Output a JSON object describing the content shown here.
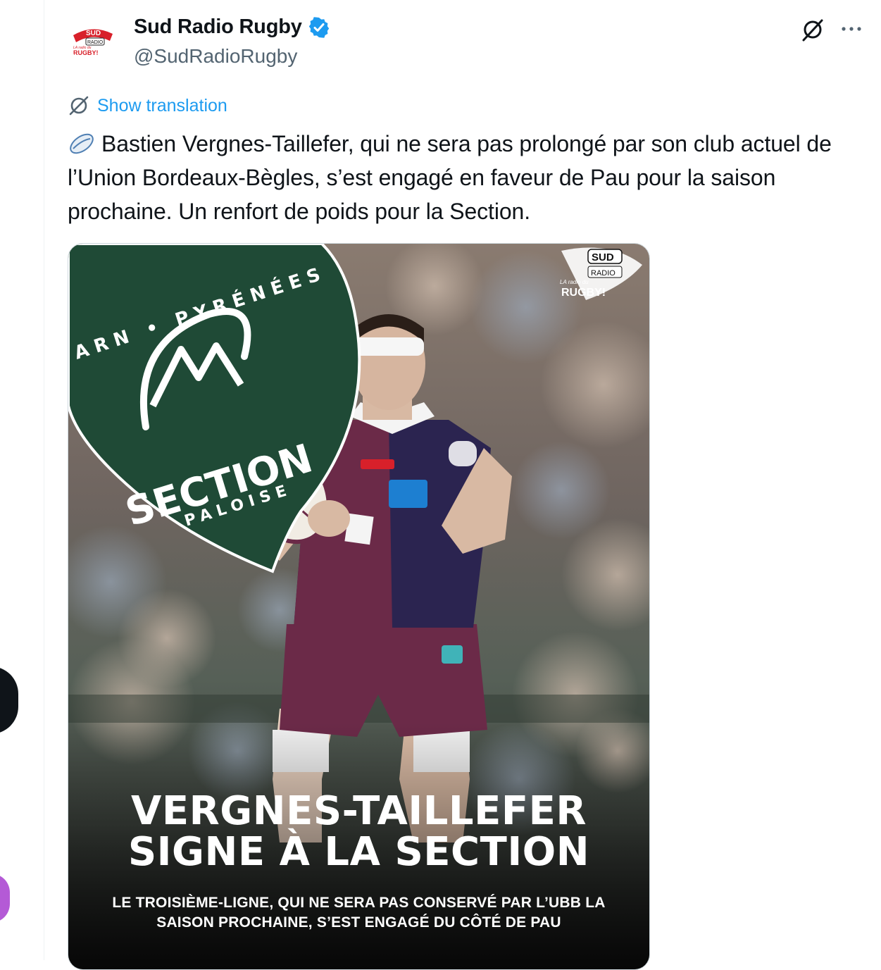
{
  "account": {
    "display_name": "Sud Radio Rugby",
    "handle": "@SudRadioRugby",
    "avatar_logo": {
      "top": "SUD",
      "middle": "RADIO",
      "small": "LA radio du",
      "bottom": "RUGBY!"
    }
  },
  "actions": {
    "translate_label": "Show translation"
  },
  "tweet": {
    "emoji_icon": "rugby-ball-icon",
    "text": "Bastien Vergnes-Taillefer, qui ne sera pas prolongé par son club actuel de l’Union Bordeaux-Bègles, s’est engagé en faveur de Pau pour la saison prochaine. Un renfort de poids pour la Section."
  },
  "media": {
    "crest_arc_text": "ARN • PYRÉNÉES",
    "crest_main_text": "SECTION",
    "crest_sub_text": "PALOISE",
    "station_logo": {
      "top": "SUD",
      "middle": "RADIO",
      "small": "LA radio du",
      "bottom": "RUGBY!"
    },
    "headline_line1": "VERGNES-TAILLEFER",
    "headline_line2": "SIGNE  À LA SECTION",
    "subline_line1": "LE TROISIÈME-LIGNE, QUI NE SERA PAS CONSERVÉ PAR L’UBB LA",
    "subline_line2": "SAISON PROCHAINE, S’EST ENGAGÉ DU CÔTÉ DE PAU"
  },
  "colors": {
    "accent_blue": "#1d9bf0",
    "crest_green": "#1f4a36",
    "jersey_bordeaux": "#6b2a48",
    "jersey_navy": "#2b2450",
    "sud_red": "#d8202a"
  }
}
